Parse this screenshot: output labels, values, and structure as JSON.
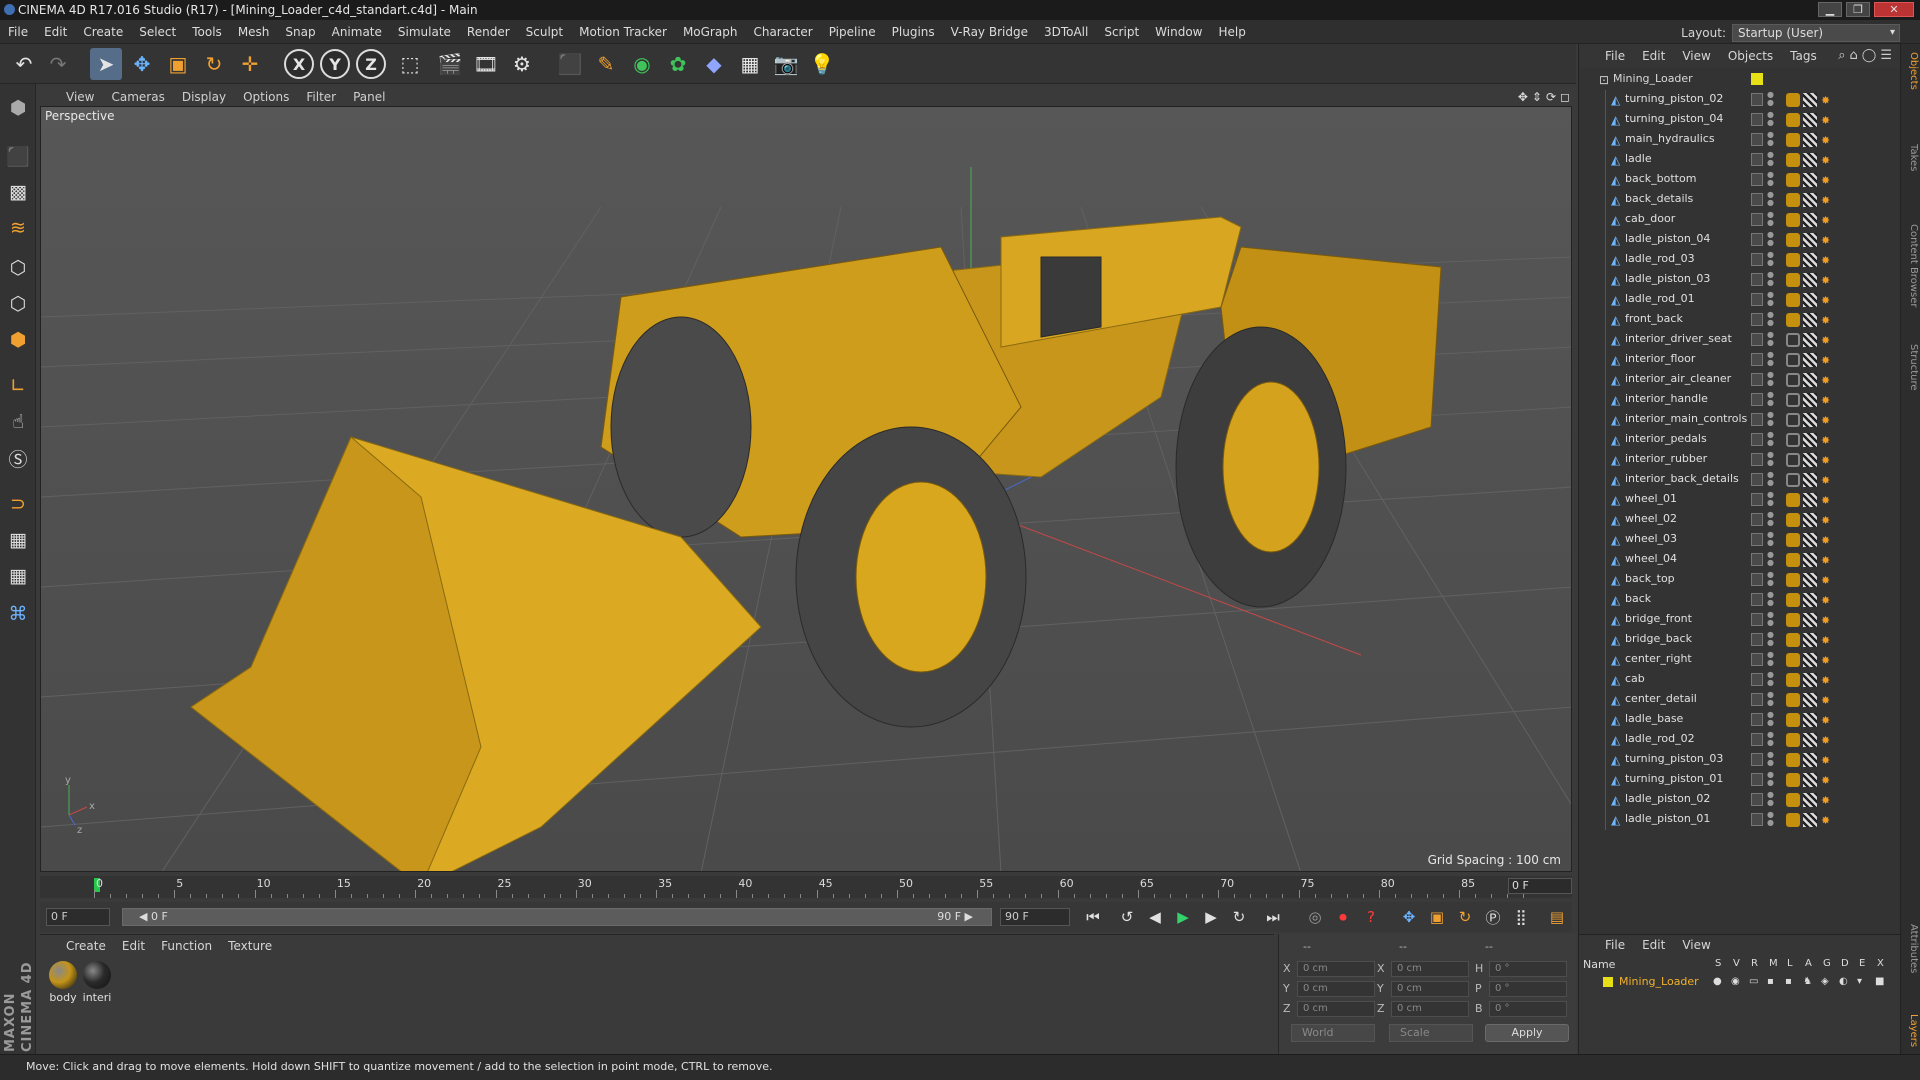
{
  "titlebar": {
    "title": "CINEMA 4D R17.016 Studio (R17) - [Mining_Loader_c4d_standart.c4d] - Main",
    "min": "▁",
    "max": "❐",
    "close": "✕"
  },
  "menus": [
    "File",
    "Edit",
    "Create",
    "Select",
    "Tools",
    "Mesh",
    "Snap",
    "Animate",
    "Simulate",
    "Render",
    "Sculpt",
    "Motion Tracker",
    "MoGraph",
    "Character",
    "Pipeline",
    "Plugins",
    "V-Ray Bridge",
    "3DToAll",
    "Script",
    "Window",
    "Help"
  ],
  "layout": {
    "label": "Layout:",
    "value": "Startup (User)"
  },
  "viewport": {
    "menus": [
      "View",
      "Cameras",
      "Display",
      "Options",
      "Filter",
      "Panel"
    ],
    "camera": "Perspective",
    "grid_spacing": "Grid Spacing : 100 cm",
    "axis_y": "y",
    "axis_x": "x",
    "axis_z": "z"
  },
  "timeline": {
    "ticks": [
      "0",
      "5",
      "10",
      "15",
      "20",
      "25",
      "30",
      "35",
      "40",
      "45",
      "50",
      "55",
      "60",
      "65",
      "70",
      "75",
      "80",
      "85",
      "90"
    ],
    "current_frame": "0 F"
  },
  "transport": {
    "start": "0 F",
    "range_start": "◀ 0 F",
    "range_end": "90 F ▶",
    "end": "90 F"
  },
  "materials": {
    "menus": [
      "Create",
      "Edit",
      "Function",
      "Texture"
    ],
    "items": [
      {
        "label": "body",
        "color": "#c49418"
      },
      {
        "label": "interi",
        "color": "#2a2a2a"
      }
    ]
  },
  "attributes": {
    "rows": [
      {
        "l1": "X",
        "v1": "0 cm",
        "l2": "X",
        "v2": "0 cm",
        "l3": "H",
        "v3": "0 °"
      },
      {
        "l1": "Y",
        "v1": "0 cm",
        "l2": "Y",
        "v2": "0 cm",
        "l3": "P",
        "v3": "0 °"
      },
      {
        "l1": "Z",
        "v1": "0 cm",
        "l2": "Z",
        "v2": "0 cm",
        "l3": "B",
        "v3": "0 °"
      }
    ],
    "coord": "World",
    "mode": "Scale",
    "apply": "Apply",
    "dashes": [
      "--",
      "--",
      "--"
    ]
  },
  "objects": {
    "menus": [
      "File",
      "Edit",
      "View",
      "Objects",
      "Tags"
    ],
    "root": "Mining_Loader",
    "items": [
      "turning_piston_02",
      "turning_piston_04",
      "main_hydraulics",
      "ladle",
      "back_bottom",
      "back_details",
      "cab_door",
      "ladle_piston_04",
      "ladle_rod_03",
      "ladle_piston_03",
      "ladle_rod_01",
      "front_back",
      "interior_driver_seat",
      "interior_floor",
      "interior_air_cleaner",
      "interior_handle",
      "interior_main_controls",
      "interior_pedals",
      "interior_rubber",
      "interior_back_details",
      "wheel_01",
      "wheel_02",
      "wheel_03",
      "wheel_04",
      "back_top",
      "back",
      "bridge_front",
      "bridge_back",
      "center_right",
      "cab",
      "center_detail",
      "ladle_base",
      "ladle_rod_02",
      "turning_piston_03",
      "turning_piston_01",
      "ladle_piston_02",
      "ladle_piston_01"
    ],
    "dark_tag_items": [
      "interior_driver_seat",
      "interior_floor",
      "interior_air_cleaner",
      "interior_handle",
      "interior_main_controls",
      "interior_pedals",
      "interior_rubber",
      "interior_back_details"
    ]
  },
  "layers": {
    "menus": [
      "File",
      "Edit",
      "View"
    ],
    "name_header": "Name",
    "columns": [
      "S",
      "V",
      "R",
      "M",
      "L",
      "A",
      "G",
      "D",
      "E",
      "X"
    ],
    "row": "Mining_Loader"
  },
  "sidetabs": [
    "Objects",
    "Takes",
    "Content Browser",
    "Structure",
    "Attributes",
    "Layers"
  ],
  "status": "Move: Click and drag to move elements. Hold down SHIFT to quantize movement / add to the selection in point mode, CTRL to remove.",
  "brand": "MAXON CINEMA 4D",
  "colors": {
    "accent": "#f0a030",
    "loader": "#d9a71e",
    "play": "#35d16a"
  }
}
